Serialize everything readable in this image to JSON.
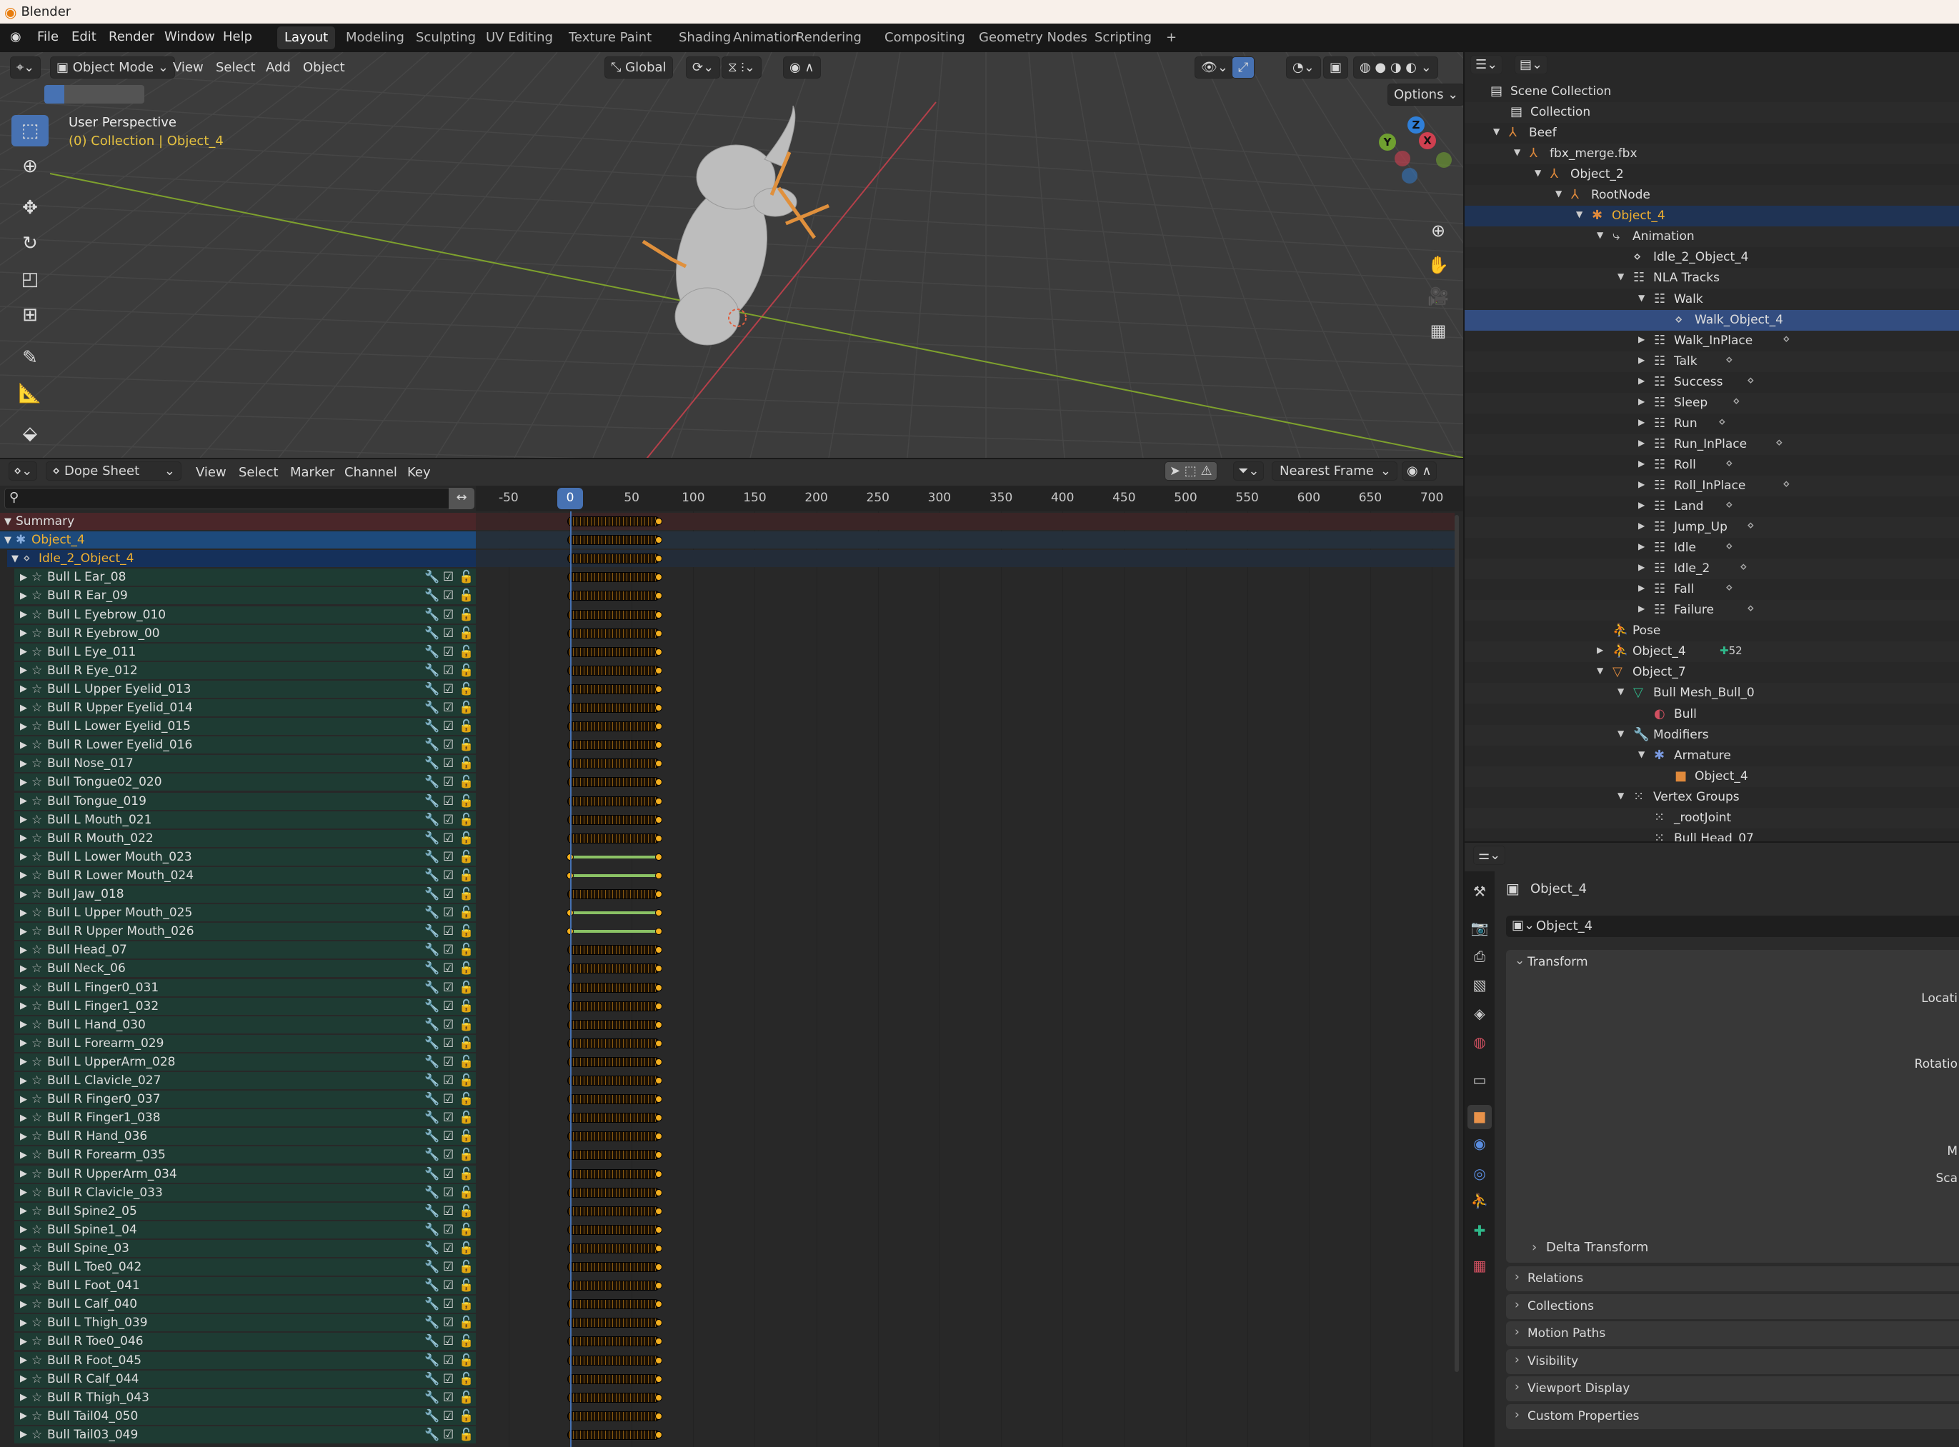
{
  "window": {
    "title": "Blender"
  },
  "menubar": {
    "menus": [
      "File",
      "Edit",
      "Render",
      "Window",
      "Help"
    ],
    "workspaces": [
      "Layout",
      "Modeling",
      "Sculpting",
      "UV Editing",
      "Texture Paint",
      "Shading",
      "Animation",
      "Rendering",
      "Compositing",
      "Geometry Nodes",
      "Scripting",
      "+"
    ],
    "active_workspace": "Layout"
  },
  "viewport": {
    "mode": "Object Mode",
    "menus": [
      "View",
      "Select",
      "Add",
      "Object"
    ],
    "orientation": "Global",
    "options_label": "Options",
    "view_name": "User Perspective",
    "context": "(0) Collection | Object_4",
    "gizmo": {
      "x": "X",
      "y": "Y",
      "z": "Z"
    },
    "colors": {
      "x_axis": "#b5404a",
      "y_axis": "#7ea12d",
      "context_text": "#e6c240"
    }
  },
  "dopesheet": {
    "editor_mode": "Dope Sheet",
    "menus": [
      "View",
      "Select",
      "Marker",
      "Channel",
      "Key"
    ],
    "snapping": "Nearest Frame",
    "search_placeholder": "",
    "current_frame": "0",
    "ruler_labels": [
      "-50",
      "0",
      "50",
      "100",
      "150",
      "200",
      "250",
      "300",
      "350",
      "400",
      "450",
      "500",
      "550",
      "600",
      "650",
      "700"
    ],
    "key_range": [
      0,
      72
    ],
    "summary": "Summary",
    "object": "Object_4",
    "action": "Idle_2_Object_4",
    "channels": [
      {
        "name": "Bull L Ear_08",
        "keys": "dense"
      },
      {
        "name": "Bull R Ear_09",
        "keys": "dense"
      },
      {
        "name": "Bull L Eyebrow_010",
        "keys": "dense"
      },
      {
        "name": "Bull R Eyebrow_00",
        "keys": "dense"
      },
      {
        "name": "Bull L Eye_011",
        "keys": "dense"
      },
      {
        "name": "Bull R Eye_012",
        "keys": "dense"
      },
      {
        "name": "Bull L Upper Eyelid_013",
        "keys": "dense"
      },
      {
        "name": "Bull R Upper Eyelid_014",
        "keys": "dense"
      },
      {
        "name": "Bull L Lower Eyelid_015",
        "keys": "dense"
      },
      {
        "name": "Bull R Lower Eyelid_016",
        "keys": "dense"
      },
      {
        "name": "Bull Nose_017",
        "keys": "dense"
      },
      {
        "name": "Bull Tongue02_020",
        "keys": "dense"
      },
      {
        "name": "Bull Tongue_019",
        "keys": "dense"
      },
      {
        "name": "Bull L Mouth_021",
        "keys": "dense"
      },
      {
        "name": "Bull R Mouth_022",
        "keys": "dense"
      },
      {
        "name": "Bull L Lower Mouth_023",
        "keys": "hold"
      },
      {
        "name": "Bull R Lower Mouth_024",
        "keys": "hold"
      },
      {
        "name": "Bull Jaw_018",
        "keys": "dense"
      },
      {
        "name": "Bull L Upper Mouth_025",
        "keys": "hold"
      },
      {
        "name": "Bull R Upper Mouth_026",
        "keys": "hold"
      },
      {
        "name": "Bull Head_07",
        "keys": "dense"
      },
      {
        "name": "Bull Neck_06",
        "keys": "dense"
      },
      {
        "name": "Bull L Finger0_031",
        "keys": "dense"
      },
      {
        "name": "Bull L Finger1_032",
        "keys": "dense"
      },
      {
        "name": "Bull L Hand_030",
        "keys": "dense"
      },
      {
        "name": "Bull L Forearm_029",
        "keys": "dense"
      },
      {
        "name": "Bull L UpperArm_028",
        "keys": "dense"
      },
      {
        "name": "Bull L Clavicle_027",
        "keys": "dense"
      },
      {
        "name": "Bull R Finger0_037",
        "keys": "dense"
      },
      {
        "name": "Bull R Finger1_038",
        "keys": "dense"
      },
      {
        "name": "Bull R Hand_036",
        "keys": "dense"
      },
      {
        "name": "Bull R Forearm_035",
        "keys": "dense"
      },
      {
        "name": "Bull R UpperArm_034",
        "keys": "dense"
      },
      {
        "name": "Bull R Clavicle_033",
        "keys": "dense"
      },
      {
        "name": "Bull Spine2_05",
        "keys": "dense"
      },
      {
        "name": "Bull Spine1_04",
        "keys": "dense"
      },
      {
        "name": "Bull Spine_03",
        "keys": "dense"
      },
      {
        "name": "Bull L Toe0_042",
        "keys": "dense"
      },
      {
        "name": "Bull L Foot_041",
        "keys": "dense"
      },
      {
        "name": "Bull L Calf_040",
        "keys": "dense"
      },
      {
        "name": "Bull L Thigh_039",
        "keys": "dense"
      },
      {
        "name": "Bull R Toe0_046",
        "keys": "dense"
      },
      {
        "name": "Bull R Foot_045",
        "keys": "dense"
      },
      {
        "name": "Bull R Calf_044",
        "keys": "dense"
      },
      {
        "name": "Bull R Thigh_043",
        "keys": "dense"
      },
      {
        "name": "Bull Tail04_050",
        "keys": "dense"
      },
      {
        "name": "Bull Tail03_049",
        "keys": "dense"
      }
    ]
  },
  "outliner": {
    "items": [
      {
        "label": "Scene Collection",
        "level": 0,
        "tri": "",
        "icon": "collection-icon",
        "glyph": "▤",
        "color": "#ddd"
      },
      {
        "label": "Collection",
        "level": 1,
        "tri": "",
        "icon": "collection-icon",
        "glyph": "▤",
        "color": "#ddd",
        "indent": true
      },
      {
        "label": "Beef",
        "level": 1,
        "tri": "down",
        "icon": "empty-icon",
        "glyph": "⅄",
        "color": "#e08a3c"
      },
      {
        "label": "fbx_merge.fbx",
        "level": 2,
        "tri": "down",
        "icon": "empty-icon",
        "glyph": "⅄",
        "color": "#e08a3c"
      },
      {
        "label": "Object_2",
        "level": 3,
        "tri": "down",
        "icon": "empty-icon",
        "glyph": "⅄",
        "color": "#e08a3c"
      },
      {
        "label": "RootNode",
        "level": 4,
        "tri": "down",
        "icon": "empty-icon",
        "glyph": "⅄",
        "color": "#e08a3c"
      },
      {
        "label": "Object_4",
        "level": 5,
        "tri": "down",
        "icon": "armature-icon",
        "glyph": "✱",
        "color": "#e08a3c",
        "state": "active"
      },
      {
        "label": "Animation",
        "level": 6,
        "tri": "down",
        "icon": "animation-icon",
        "glyph": "⤷",
        "color": "#ccc"
      },
      {
        "label": "Idle_2_Object_4",
        "level": 7,
        "tri": "",
        "icon": "action-icon",
        "glyph": "⋄",
        "color": "#ccc"
      },
      {
        "label": "NLA Tracks",
        "level": 7,
        "tri": "down",
        "icon": "nla-icon",
        "glyph": "☷",
        "color": "#ccc"
      },
      {
        "label": "Walk",
        "level": 8,
        "tri": "down",
        "icon": "nla-track-icon",
        "glyph": "☷",
        "color": "#ccc"
      },
      {
        "label": "Walk_Object_4",
        "level": 9,
        "tri": "",
        "icon": "action-icon",
        "glyph": "⋄",
        "color": "#ccc",
        "state": "selected"
      },
      {
        "label": "Walk_InPlace",
        "level": 8,
        "tri": "right",
        "icon": "nla-track-icon",
        "glyph": "☷",
        "color": "#ccc",
        "action": true
      },
      {
        "label": "Talk",
        "level": 8,
        "tri": "right",
        "icon": "nla-track-icon",
        "glyph": "☷",
        "color": "#ccc",
        "action": true
      },
      {
        "label": "Success",
        "level": 8,
        "tri": "right",
        "icon": "nla-track-icon",
        "glyph": "☷",
        "color": "#ccc",
        "action": true
      },
      {
        "label": "Sleep",
        "level": 8,
        "tri": "right",
        "icon": "nla-track-icon",
        "glyph": "☷",
        "color": "#ccc",
        "action": true
      },
      {
        "label": "Run",
        "level": 8,
        "tri": "right",
        "icon": "nla-track-icon",
        "glyph": "☷",
        "color": "#ccc",
        "action": true
      },
      {
        "label": "Run_InPlace",
        "level": 8,
        "tri": "right",
        "icon": "nla-track-icon",
        "glyph": "☷",
        "color": "#ccc",
        "action": true
      },
      {
        "label": "Roll",
        "level": 8,
        "tri": "right",
        "icon": "nla-track-icon",
        "glyph": "☷",
        "color": "#ccc",
        "action": true
      },
      {
        "label": "Roll_InPlace",
        "level": 8,
        "tri": "right",
        "icon": "nla-track-icon",
        "glyph": "☷",
        "color": "#ccc",
        "action": true
      },
      {
        "label": "Land",
        "level": 8,
        "tri": "right",
        "icon": "nla-track-icon",
        "glyph": "☷",
        "color": "#ccc",
        "action": true
      },
      {
        "label": "Jump_Up",
        "level": 8,
        "tri": "right",
        "icon": "nla-track-icon",
        "glyph": "☷",
        "color": "#ccc",
        "action": true
      },
      {
        "label": "Idle",
        "level": 8,
        "tri": "right",
        "icon": "nla-track-icon",
        "glyph": "☷",
        "color": "#ccc",
        "action": true
      },
      {
        "label": "Idle_2",
        "level": 8,
        "tri": "right",
        "icon": "nla-track-icon",
        "glyph": "☷",
        "color": "#ccc",
        "action": true
      },
      {
        "label": "Fall",
        "level": 8,
        "tri": "right",
        "icon": "nla-track-icon",
        "glyph": "☷",
        "color": "#ccc",
        "action": true
      },
      {
        "label": "Failure",
        "level": 8,
        "tri": "right",
        "icon": "nla-track-icon",
        "glyph": "☷",
        "color": "#ccc",
        "action": true
      },
      {
        "label": "Pose",
        "level": 6,
        "tri": "",
        "icon": "pose-icon",
        "glyph": "⛹",
        "color": "#2fb88a"
      },
      {
        "label": "Object_4",
        "level": 6,
        "tri": "right",
        "icon": "armature-data-icon",
        "glyph": "⛹",
        "color": "#2fb88a",
        "badge": "52"
      },
      {
        "label": "Object_7",
        "level": 6,
        "tri": "down",
        "icon": "mesh-object-icon",
        "glyph": "▽",
        "color": "#e08a3c"
      },
      {
        "label": "Bull Mesh_Bull_0",
        "level": 7,
        "tri": "down",
        "icon": "mesh-data-icon",
        "glyph": "▽",
        "color": "#2fb88a"
      },
      {
        "label": "Bull",
        "level": 8,
        "tri": "",
        "icon": "material-icon",
        "glyph": "◐",
        "color": "#d05060"
      },
      {
        "label": "Modifiers",
        "level": 7,
        "tri": "down",
        "icon": "wrench-icon",
        "glyph": "🔧",
        "color": "#6a8fd8"
      },
      {
        "label": "Armature",
        "level": 8,
        "tri": "down",
        "icon": "armature-modifier-icon",
        "glyph": "✱",
        "color": "#7a9ae0"
      },
      {
        "label": "Object_4",
        "level": 9,
        "tri": "",
        "icon": "object-icon",
        "glyph": "■",
        "color": "#e08a3c"
      },
      {
        "label": "Vertex Groups",
        "level": 7,
        "tri": "down",
        "icon": "vertex-groups-icon",
        "glyph": "⁙",
        "color": "#ccc"
      },
      {
        "label": "_rootJoint",
        "level": 8,
        "tri": "",
        "icon": "vertex-group-icon",
        "glyph": "⁙",
        "color": "#ccc"
      },
      {
        "label": "Bull Head_07",
        "level": 8,
        "tri": "",
        "icon": "vertex-group-icon",
        "glyph": "⁙",
        "color": "#ccc"
      }
    ]
  },
  "properties": {
    "object_name": "Object_4",
    "datablock": "Object_4",
    "transform": {
      "title": "Transform",
      "labels": [
        "Locati",
        "Rotatio",
        "M",
        "Sca"
      ],
      "delta": "Delta Transform"
    },
    "panels": [
      "Relations",
      "Collections",
      "Motion Paths",
      "Visibility",
      "Viewport Display",
      "Custom Properties"
    ],
    "tabs": [
      {
        "name": "tool-tab",
        "glyph": "⚒",
        "color": "#ccc"
      },
      {
        "name": "render-tab",
        "glyph": "📷",
        "color": "#ccc"
      },
      {
        "name": "output-tab",
        "glyph": "⎙",
        "color": "#ccc"
      },
      {
        "name": "view-layer-tab",
        "glyph": "▧",
        "color": "#ccc"
      },
      {
        "name": "scene-tab",
        "glyph": "◈",
        "color": "#ccc"
      },
      {
        "name": "world-tab",
        "glyph": "◍",
        "color": "#d05060"
      },
      {
        "name": "collection-tab",
        "glyph": "▭",
        "color": "#ccc"
      },
      {
        "name": "object-tab",
        "glyph": "■",
        "color": "#e8924a",
        "active": true
      },
      {
        "name": "physics-tab",
        "glyph": "◉",
        "color": "#5a8de0"
      },
      {
        "name": "constraints-tab",
        "glyph": "◎",
        "color": "#5a8de0"
      },
      {
        "name": "object-data-tab",
        "glyph": "⛹",
        "color": "#2fb88a"
      },
      {
        "name": "bone-tab",
        "glyph": "✚",
        "color": "#2fb88a"
      },
      {
        "name": "texture-tab",
        "glyph": "▦",
        "color": "#d05060"
      }
    ]
  }
}
